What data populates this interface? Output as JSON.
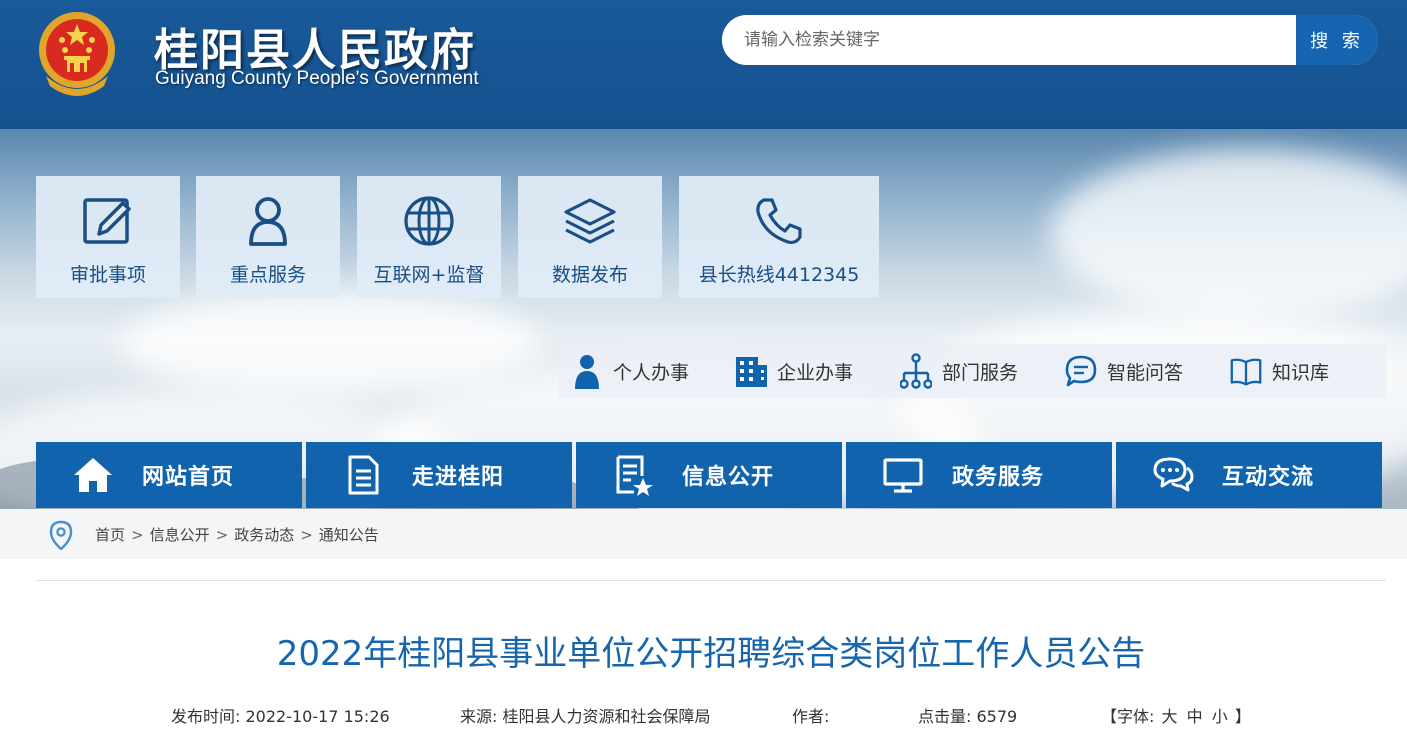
{
  "header": {
    "title": "桂阳县人民政府",
    "subtitle": "Guiyang County People's Government",
    "search_placeholder": "请输入检索关键字",
    "search_button": "搜 索"
  },
  "tiles": [
    {
      "label": "审批事项",
      "icon": "edit-icon"
    },
    {
      "label": "重点服务",
      "icon": "user-icon"
    },
    {
      "label": "互联网+监督",
      "icon": "globe-icon"
    },
    {
      "label": "数据发布",
      "icon": "layers-icon"
    },
    {
      "label": "县长热线4412345",
      "icon": "phone-icon"
    }
  ],
  "quick_links": [
    {
      "label": "个人办事",
      "icon": "person-icon"
    },
    {
      "label": "企业办事",
      "icon": "building-icon"
    },
    {
      "label": "部门服务",
      "icon": "org-chart-icon"
    },
    {
      "label": "智能问答",
      "icon": "chat-bubble-icon"
    },
    {
      "label": "知识库",
      "icon": "book-icon"
    }
  ],
  "nav": [
    {
      "label": "网站首页",
      "icon": "home-icon"
    },
    {
      "label": "走进桂阳",
      "icon": "document-icon"
    },
    {
      "label": "信息公开",
      "icon": "doc-star-icon"
    },
    {
      "label": "政务服务",
      "icon": "monitor-icon"
    },
    {
      "label": "互动交流",
      "icon": "chat-icon"
    }
  ],
  "breadcrumb": [
    "首页",
    "信息公开",
    "政务动态",
    "通知公告"
  ],
  "breadcrumb_sep": ">",
  "article": {
    "title": "2022年桂阳县事业单位公开招聘综合类岗位工作人员公告",
    "publish_label": "发布时间:",
    "publish_time": "2022-10-17 15:26",
    "source_label": "来源:",
    "source": "桂阳县人力资源和社会保障局",
    "author_label": "作者:",
    "author": "",
    "views_label": "点击量:",
    "views": "6579",
    "font_open": "【字体:",
    "font_large": "大",
    "font_medium": "中",
    "font_small": "小",
    "font_close": "】"
  },
  "colors": {
    "header_blue": "#14518f",
    "nav_blue": "#1263ad",
    "title_blue": "#1765ad",
    "tile_bg": "#e0ecf6"
  }
}
